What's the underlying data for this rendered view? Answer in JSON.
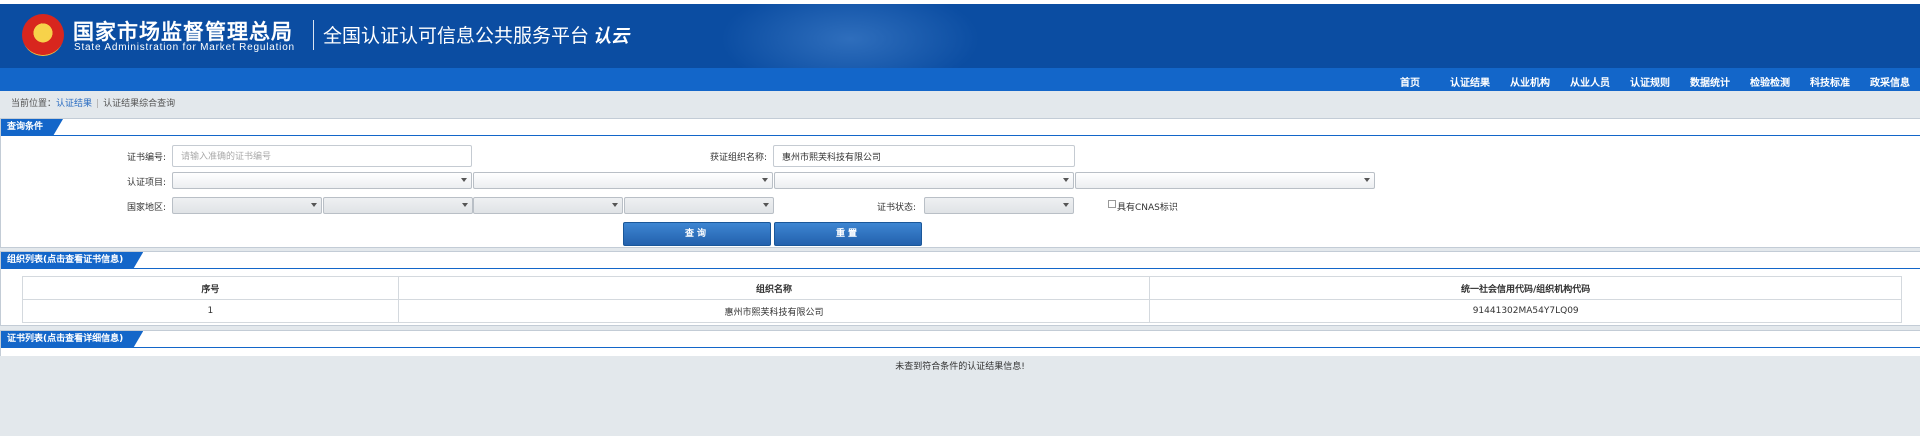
{
  "header": {
    "agency_cn": "国家市场监督管理总局",
    "agency_en": "State Administration for Market Regulation",
    "platform": "全国认证认可信息公共服务平台",
    "cloud_logo": "认云"
  },
  "nav": [
    "首页",
    "认证结果",
    "从业机构",
    "从业人员",
    "认证规则",
    "数据统计",
    "检验检测",
    "科技标准",
    "政采信息"
  ],
  "breadcrumb": {
    "prefix": "当前位置：",
    "link": "认证结果",
    "current": "认证结果综合查询"
  },
  "query_panel": {
    "title": "查询条件",
    "cert_no_label": "证书编号:",
    "cert_no_placeholder": "请输入准确的证书编号",
    "cert_no_value": "",
    "org_name_label": "获证组织名称:",
    "org_name_value": "惠州市熙芙科技有限公司",
    "cert_item_label": "认证项目:",
    "region_label": "国家地区:",
    "status_label": "证书状态:",
    "cnas_label": "具有CNAS标识",
    "search_button": "查询",
    "reset_button": "重置"
  },
  "org_panel": {
    "title": "组织列表(点击查看证书信息)",
    "columns": [
      "序号",
      "组织名称",
      "统一社会信用代码/组织机构代码"
    ],
    "rows": [
      [
        "1",
        "惠州市熙芙科技有限公司",
        "91441302MA54Y7LQ09"
      ]
    ]
  },
  "cert_panel": {
    "title": "证书列表(点击查看详细信息)",
    "empty_message": "未查到符合条件的认证结果信息!"
  },
  "colors": {
    "header_bg": "#0b4da2",
    "nav_bg": "#1366c9",
    "page_bg": "#e3e8ec",
    "button_bg": "#2a6cbd"
  }
}
